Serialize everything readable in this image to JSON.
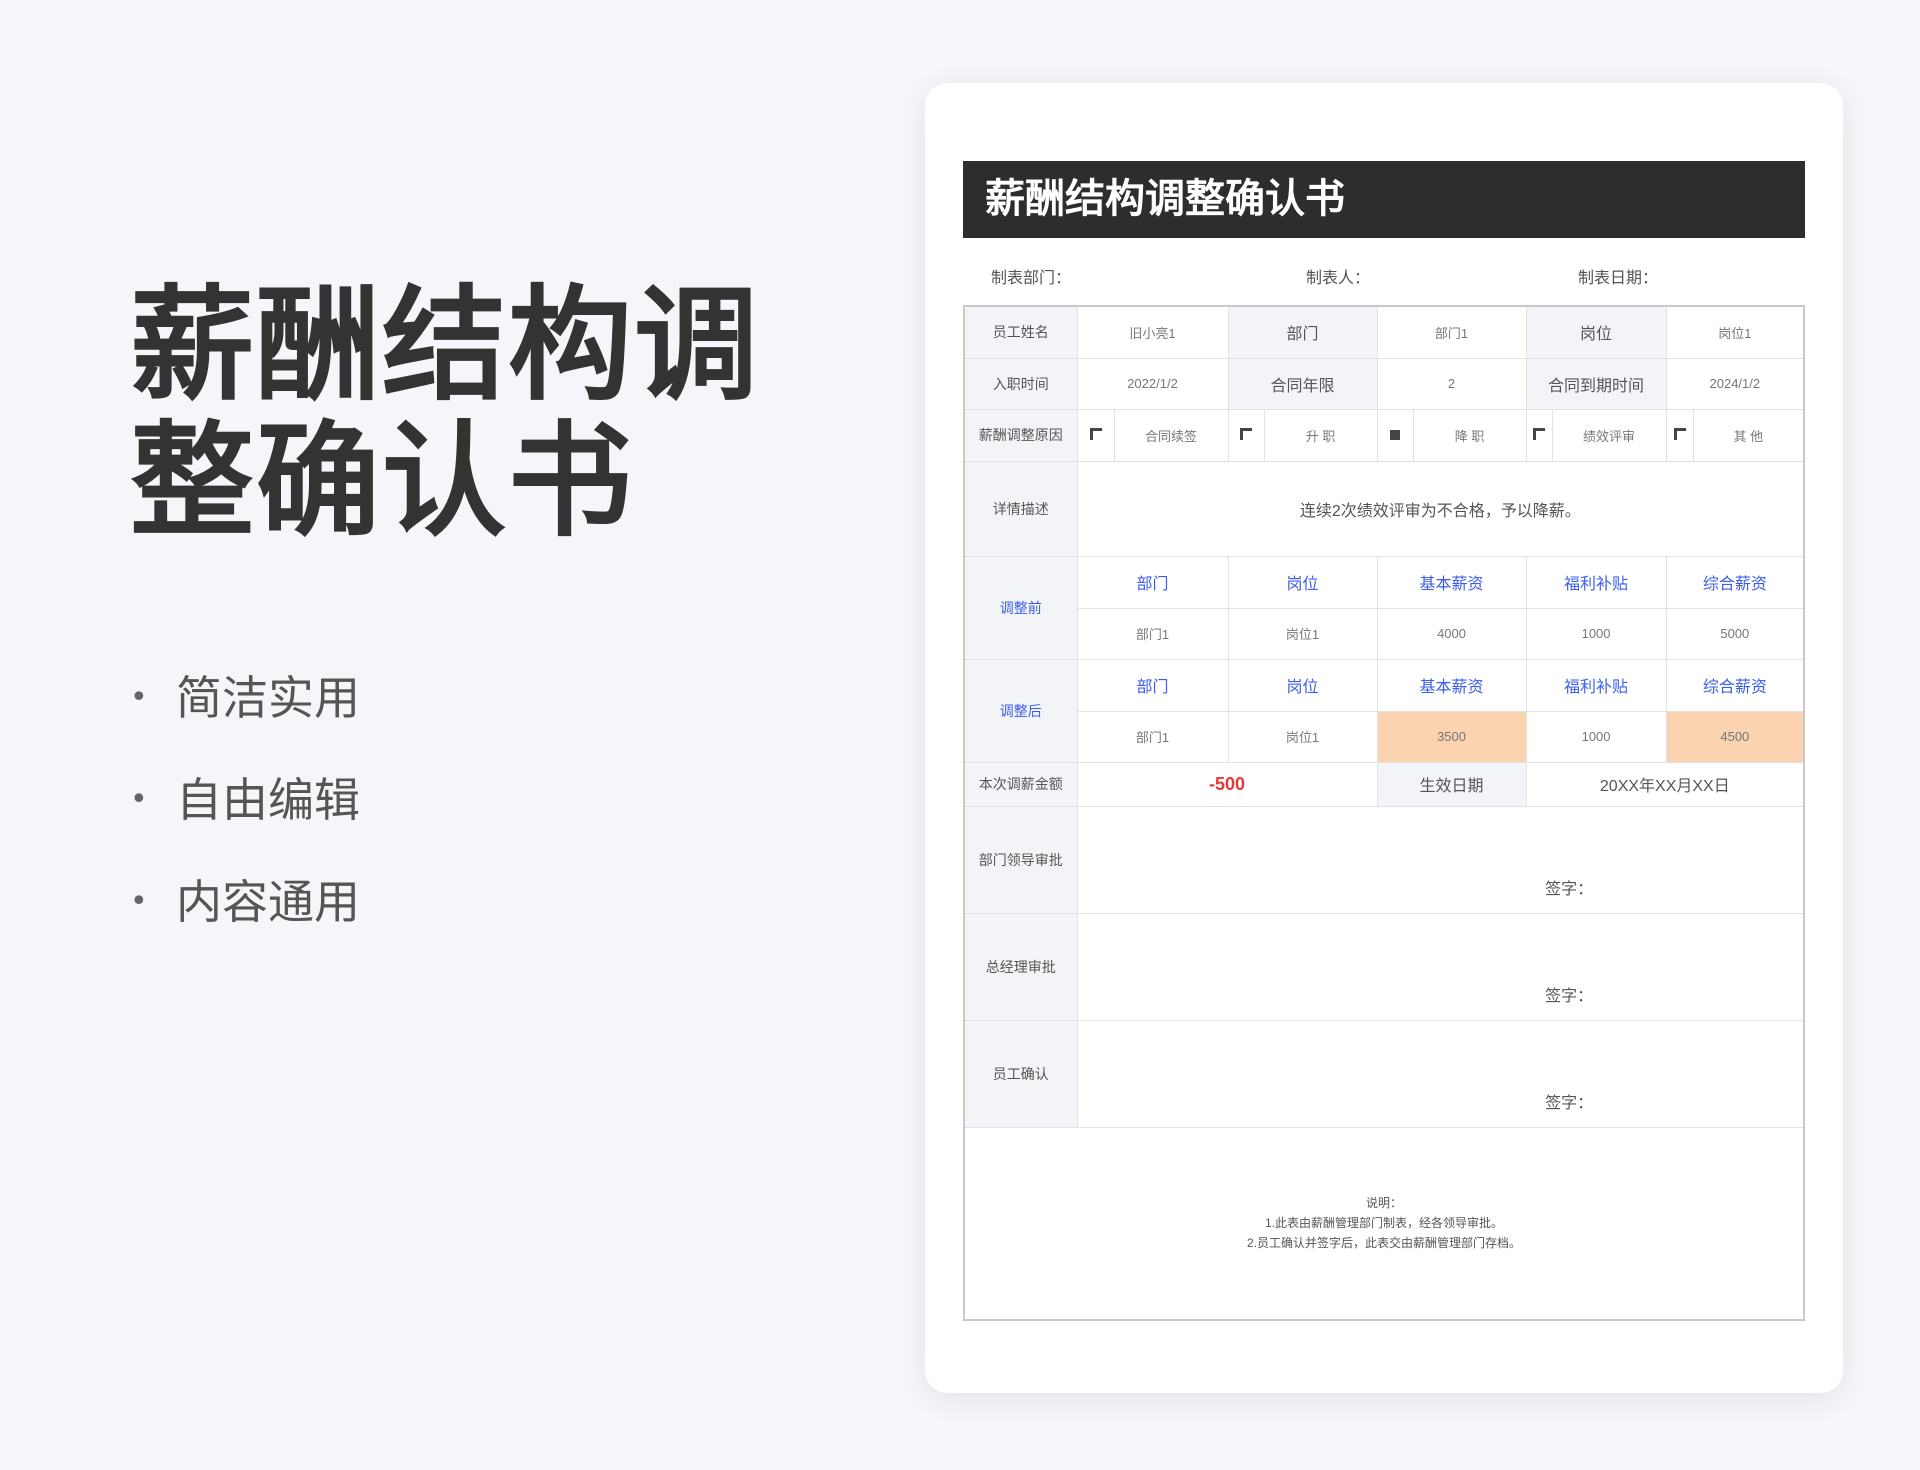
{
  "hero": {
    "title": "薪酬结构调整确认书"
  },
  "features": [
    "简洁实用",
    "自由编辑",
    "内容通用"
  ],
  "doc": {
    "title": "薪酬结构调整确认书",
    "meta": {
      "dept": "制表部门：",
      "maker": "制表人：",
      "date": "制表日期："
    },
    "row1": {
      "name_label": "员工姓名",
      "name": "旧小亮1",
      "dept_label": "部门",
      "dept": "部门1",
      "post_label": "岗位",
      "post": "岗位1"
    },
    "row2": {
      "join_label": "入职时间",
      "join": "2022/1/2",
      "years_label": "合同年限",
      "years": "2",
      "expire_label": "合同到期时间",
      "expire": "2024/1/2"
    },
    "reason": {
      "label": "薪酬调整原因",
      "options": [
        {
          "text": "合同续签",
          "checked": false
        },
        {
          "text": "升  职",
          "checked": false
        },
        {
          "text": "降  职",
          "checked": true
        },
        {
          "text": "绩效评审",
          "checked": false
        },
        {
          "text": "其  他",
          "checked": false
        }
      ]
    },
    "detail": {
      "label": "详情描述",
      "text": "连续2次绩效评审为不合格，予以降薪。"
    },
    "before": {
      "label": "调整前",
      "headers": [
        "部门",
        "岗位",
        "基本薪资",
        "福利补贴",
        "综合薪资"
      ],
      "values": [
        "部门1",
        "岗位1",
        "4000",
        "1000",
        "5000"
      ]
    },
    "after": {
      "label": "调整后",
      "headers": [
        "部门",
        "岗位",
        "基本薪资",
        "福利补贴",
        "综合薪资"
      ],
      "values": [
        "部门1",
        "岗位1",
        "3500",
        "1000",
        "4500"
      ]
    },
    "amount": {
      "label": "本次调薪金额",
      "value": "-500",
      "eff_label": "生效日期",
      "eff": "20XX年XX月XX日"
    },
    "approvals": [
      {
        "label": "部门领导审批",
        "sign": "签字："
      },
      {
        "label": "总经理审批",
        "sign": "签字："
      },
      {
        "label": "员工确认",
        "sign": "签字："
      }
    ],
    "notes": [
      "说明：",
      "1.此表由薪酬管理部门制表，经各领导审批。",
      "2.员工确认并签字后，此表交由薪酬管理部门存档。"
    ]
  }
}
